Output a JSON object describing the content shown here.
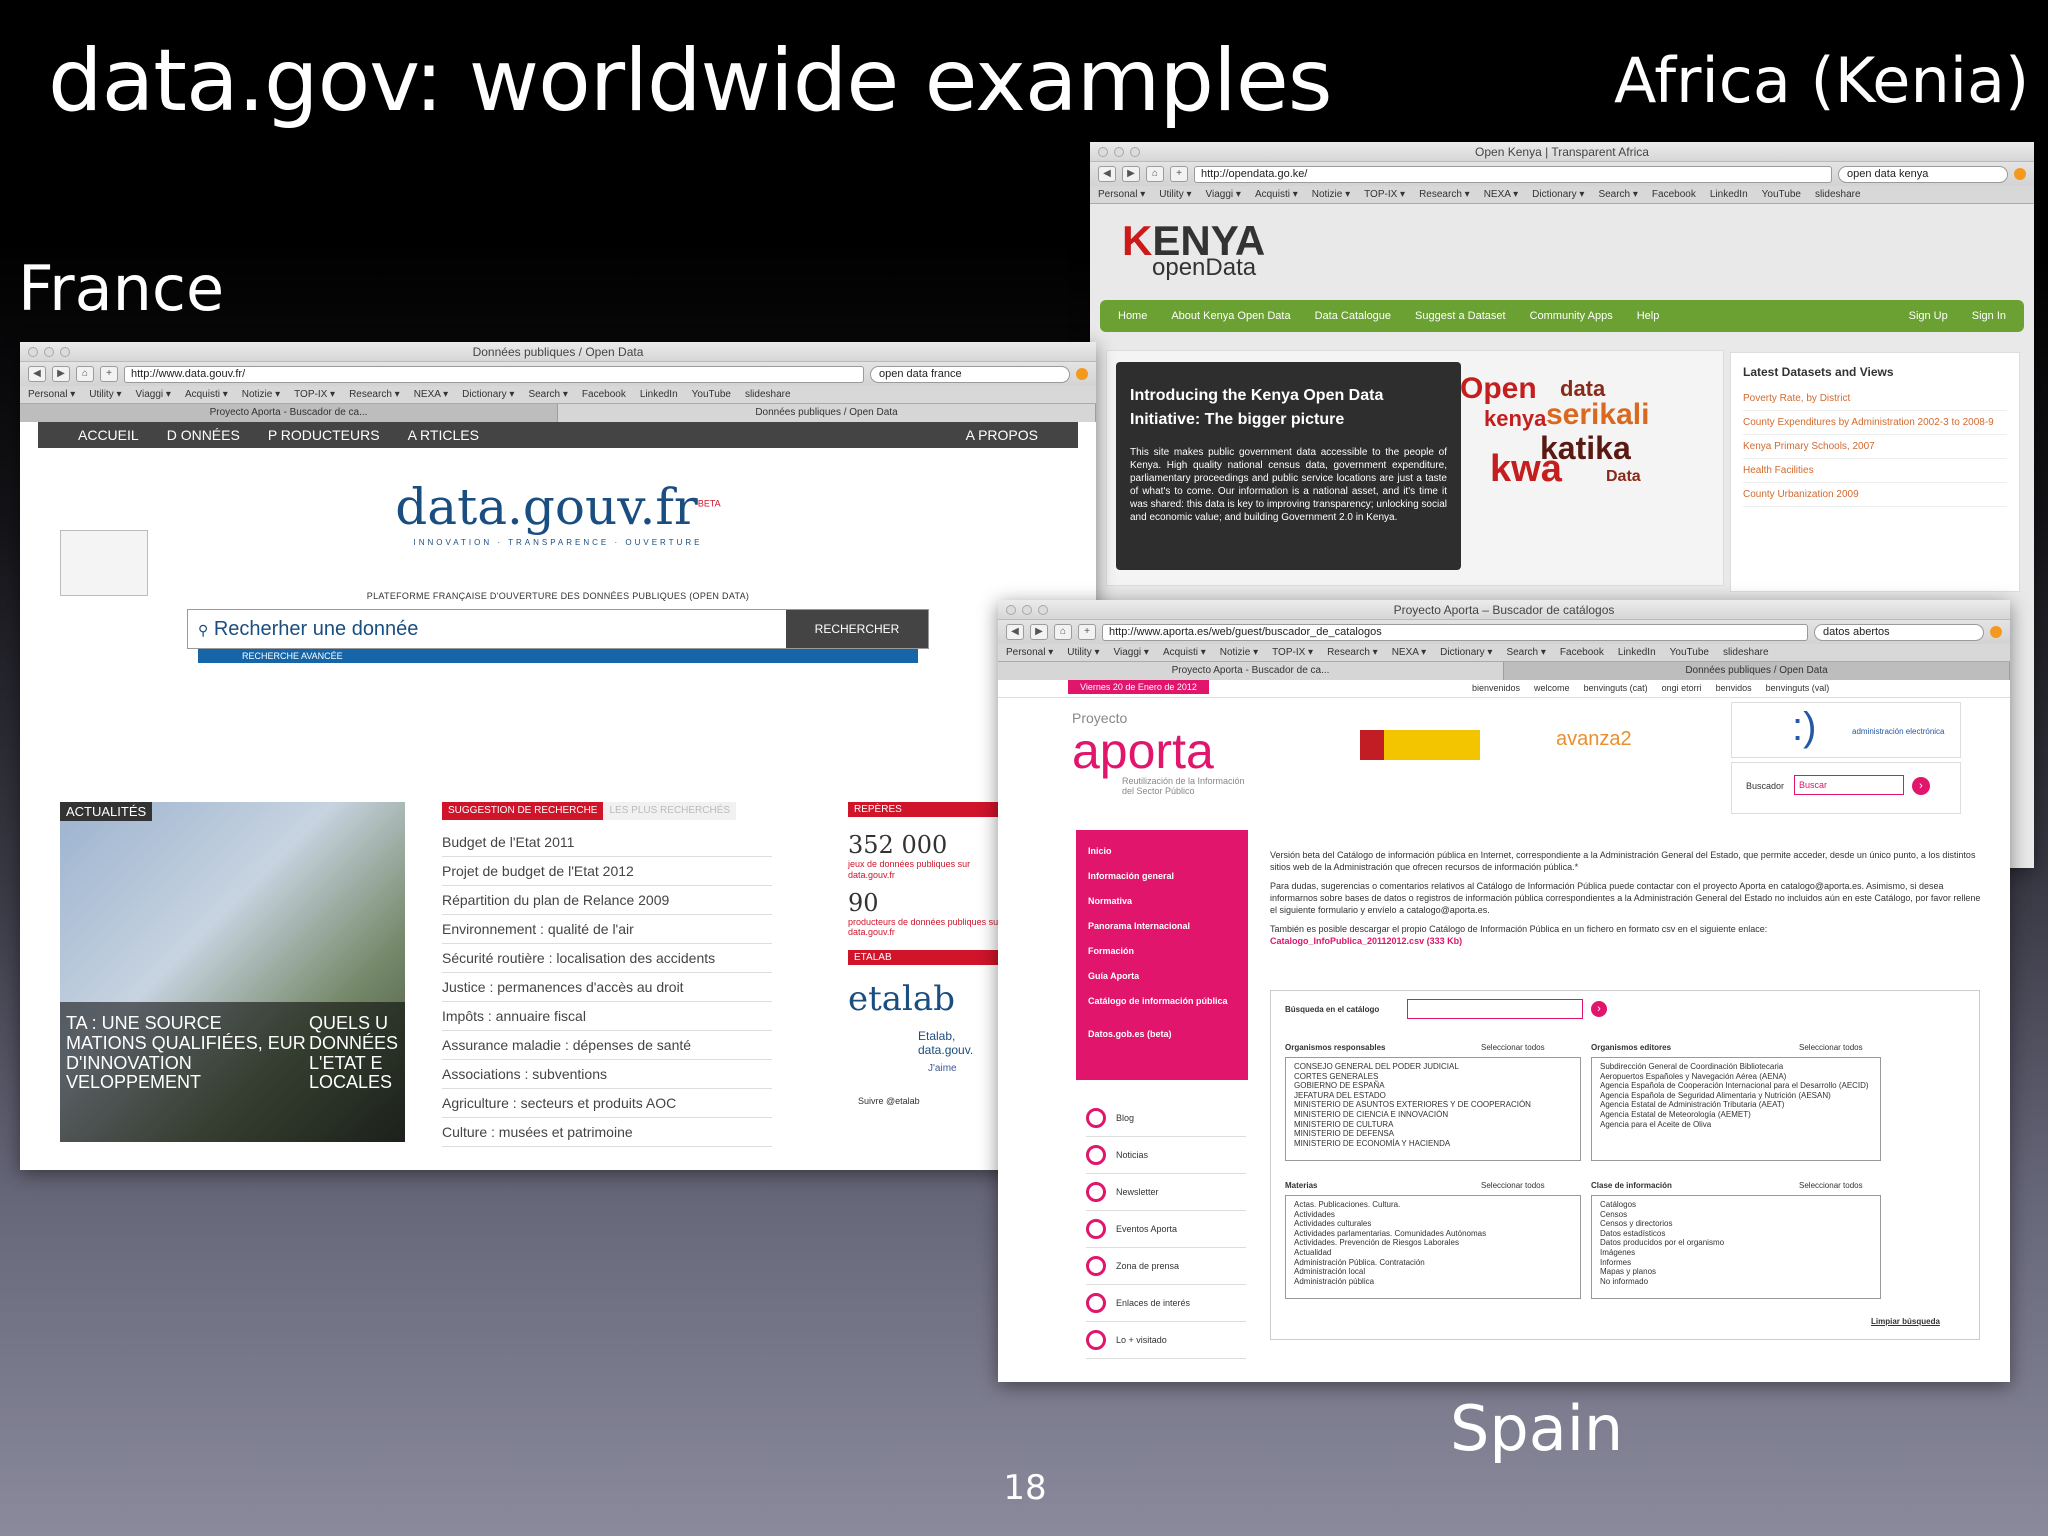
{
  "slide": {
    "title": "data.gov: worldwide examples",
    "page_number": "18"
  },
  "regions": {
    "france": "France",
    "africa": "Africa (Kenia)",
    "spain": "Spain"
  },
  "france": {
    "window_title": "Données publiques / Open Data",
    "url": "http://www.data.gouv.fr/",
    "search_field": "open data france",
    "bookmarks": [
      "Personal ▾",
      "Utility ▾",
      "Viaggi ▾",
      "Acquisti ▾",
      "Notizie ▾",
      "TOP-IX ▾",
      "Research ▾",
      "NEXA ▾",
      "Dictionary ▾",
      "Search ▾",
      "Facebook",
      "LinkedIn",
      "YouTube",
      "slideshare"
    ],
    "tabs": [
      "Proyecto Aporta - Buscador de ca...",
      "Données publiques / Open Data"
    ],
    "nav": [
      "ACCUEIL",
      "D ONNÉES",
      "P RODUCTEURS",
      "A RTICLES"
    ],
    "nav_right": "A PROPOS",
    "logo": "data.gouv.fr",
    "logo_beta": "BETA",
    "logo_sub": "INNOVATION · TRANSPARENCE · OUVERTURE",
    "platform_label": "PLATEFORME FRANÇAISE D'OUVERTURE DES DONNÉES PUBLIQUES (OPEN DATA)",
    "search_placeholder": "Recherher une donnée",
    "search_button": "RECHERCHER",
    "advanced_search": "RECHERCHE AVANCÉE",
    "news_tag": "ACTUALITÉS",
    "news_caption_1": "TA : UNE SOURCE MATIONS QUALIFIÉES, EUR D'INNOVATION VELOPPEMENT",
    "news_caption_2": "QUELS U DONNÉES L'ETAT E LOCALES",
    "suggestion_tab": "SUGGESTION DE RECHERCHE",
    "most_searched_tab": "LES PLUS RECHERCHÉS",
    "suggestions": [
      "Budget de l'Etat 2011",
      "Projet de budget de l'Etat 2012",
      "Répartition du plan de Relance 2009",
      "Environnement : qualité de l'air",
      "Sécurité routière : localisation des accidents",
      "Justice : permanences d'accès au droit",
      "Impôts : annuaire fiscal",
      "Assurance maladie : dépenses de santé",
      "Associations : subventions",
      "Agriculture : secteurs et produits AOC",
      "Culture : musées et patrimoine"
    ],
    "reperes_tag": "REPÈRES",
    "stat_1": "352 000",
    "stat_1_label": "jeux de données publiques sur data.gouv.fr",
    "stat_2": "90",
    "stat_2_label": "producteurs de données publiques sur data.gouv.fr",
    "etalab_tag": "ETALAB",
    "etalab_logo": "etalab",
    "etalab_text": "Etalab, data.gouv.",
    "like_button": "J'aime",
    "follow_button": "Suivre @etalab"
  },
  "kenya": {
    "window_title": "Open Kenya | Transparent Africa",
    "url": "http://opendata.go.ke/",
    "search_field": "open data kenya",
    "bookmarks": [
      "Personal ▾",
      "Utility ▾",
      "Viaggi ▾",
      "Acquisti ▾",
      "Notizie ▾",
      "TOP-IX ▾",
      "Research ▾",
      "NEXA ▾",
      "Dictionary ▾",
      "Search ▾",
      "Facebook",
      "LinkedIn",
      "YouTube",
      "slideshare"
    ],
    "logo_main": "ENYA",
    "logo_k": "K",
    "logo_sub": "openData",
    "nav": [
      "Home",
      "About Kenya Open Data",
      "Data Catalogue",
      "Suggest a Dataset",
      "Community Apps",
      "Help"
    ],
    "nav_right": [
      "Sign Up",
      "Sign In"
    ],
    "hero_title": "Introducing the Kenya Open Data Initiative: The bigger picture",
    "hero_text": "This site makes public government data accessible to the people of Kenya. High quality national census data, government expenditure, parliamentary proceedings and public service locations are just a taste of what's to come. Our information is a national asset, and it's time it was shared: this data is key to improving transparency; unlocking social and economic value; and building Government 2.0 in Kenya.",
    "cloud_words": [
      "Open",
      "data",
      "kenya",
      "serikali",
      "katika",
      "kwa",
      "Data"
    ],
    "latest_title": "Latest Datasets and Views",
    "latest": [
      "Poverty Rate, by District",
      "County Expenditures by Administration 2002-3 to 2008-9",
      "Kenya Primary Schools, 2007",
      "Health Facilities",
      "County Urbanization 2009"
    ]
  },
  "spain": {
    "window_title": "Proyecto Aporta – Buscador de catálogos",
    "url": "http://www.aporta.es/web/guest/buscador_de_catalogos",
    "search_field": "datos abertos",
    "bookmarks": [
      "Personal ▾",
      "Utility ▾",
      "Viaggi ▾",
      "Acquisti ▾",
      "Notizie ▾",
      "TOP-IX ▾",
      "Research ▾",
      "NEXA ▾",
      "Dictionary ▾",
      "Search ▾",
      "Facebook",
      "LinkedIn",
      "YouTube",
      "slideshare"
    ],
    "tabs": [
      "Proyecto Aporta - Buscador de ca...",
      "Données publiques / Open Data"
    ],
    "date": "Viernes 20 de Enero de 2012",
    "languages": [
      "bienvenidos",
      "welcome",
      "benvinguts (cat)",
      "ongi etorri",
      "benvidos",
      "benvinguts (val)"
    ],
    "logo_pre": "Proyecto",
    "logo": "aporta",
    "logo_sub": "Reutilización de la Información del Sector Público",
    "plan_logo": "avanza2",
    "admin_logo": "administración electrónica",
    "search_label": "Buscador",
    "search_placeholder": "Buscar",
    "sidebar": [
      "Inicio",
      "Información general",
      "Normativa",
      "Panorama Internacional",
      "Formación",
      "Guía Aporta",
      "Catálogo de información pública",
      "Datos.gob.es (beta)"
    ],
    "links": [
      "Blog",
      "Noticias",
      "Newsletter",
      "Eventos Aporta",
      "Zona de prensa",
      "Enlaces de interés",
      "Lo + visitado"
    ],
    "intro_1": "Versión beta del Catálogo de información pública en Internet, correspondiente a la Administración General del Estado, que permite acceder, desde un único punto, a los distintos sitios web de la Administración que ofrecen recursos de información pública.*",
    "intro_2": "Para dudas, sugerencias o comentarios relativos al Catálogo de Información Pública puede contactar con el proyecto Aporta en catalogo@aporta.es. Asimismo, si desea informarnos sobre bases de datos o registros de información pública correspondientes a la Administración General del Estado no incluidos aún en este Catálogo, por favor rellene el siguiente formulario y envíelo a catalogo@aporta.es.",
    "intro_3": "También es posible descargar el propio Catálogo de Información Pública en un fichero en formato csv en el siguiente enlace:",
    "download": "Catalogo_InfoPublica_20112012.csv (333 Kb)",
    "catalog_search": "Búsqueda en el catálogo",
    "org_resp": "Organismos responsables",
    "org_edit": "Organismos editores",
    "select_all": "Seleccionar todos",
    "org_resp_items": [
      "CONSEJO GENERAL DEL PODER JUDICIAL",
      "CORTES GENERALES",
      "GOBIERNO DE ESPAÑA",
      "JEFATURA DEL ESTADO",
      "MINISTERIO DE ASUNTOS EXTERIORES Y DE COOPERACIÓN",
      "MINISTERIO DE CIENCIA E INNOVACIÓN",
      "MINISTERIO DE CULTURA",
      "MINISTERIO DE DEFENSA",
      "MINISTERIO DE ECONOMÍA Y HACIENDA"
    ],
    "org_edit_items": [
      "Subdirección General de Coordinación Bibliotecaria",
      "Aeropuertos Españoles y Navegación Aérea (AENA)",
      "Agencia Española de Cooperación Internacional para el Desarrollo (AECID)",
      "Agencia Española de Seguridad Alimentaria y Nutrición (AESAN)",
      "Agencia Estatal de Administración Tributaria (AEAT)",
      "Agencia Estatal de Meteorología (AEMET)",
      "Agencia para el Aceite de Oliva"
    ],
    "materias": "Materias",
    "materias_items": [
      "Actas. Publicaciones. Cultura.",
      "Actividades",
      "Actividades culturales",
      "Actividades parlamentarias. Comunidades Autónomas",
      "Actividades. Prevención de Riesgos Laborales",
      "Actualidad",
      "Administración Pública. Contratación",
      "Administración local",
      "Administración pública"
    ],
    "clase": "Clase de información",
    "clase_items": [
      "Catálogos",
      "Censos",
      "Censos y directorios",
      "Datos estadísticos",
      "Datos producidos por el organismo",
      "Imágenes",
      "Informes",
      "Mapas y planos",
      "No informado"
    ],
    "clear": "Limpiar búsqueda"
  }
}
